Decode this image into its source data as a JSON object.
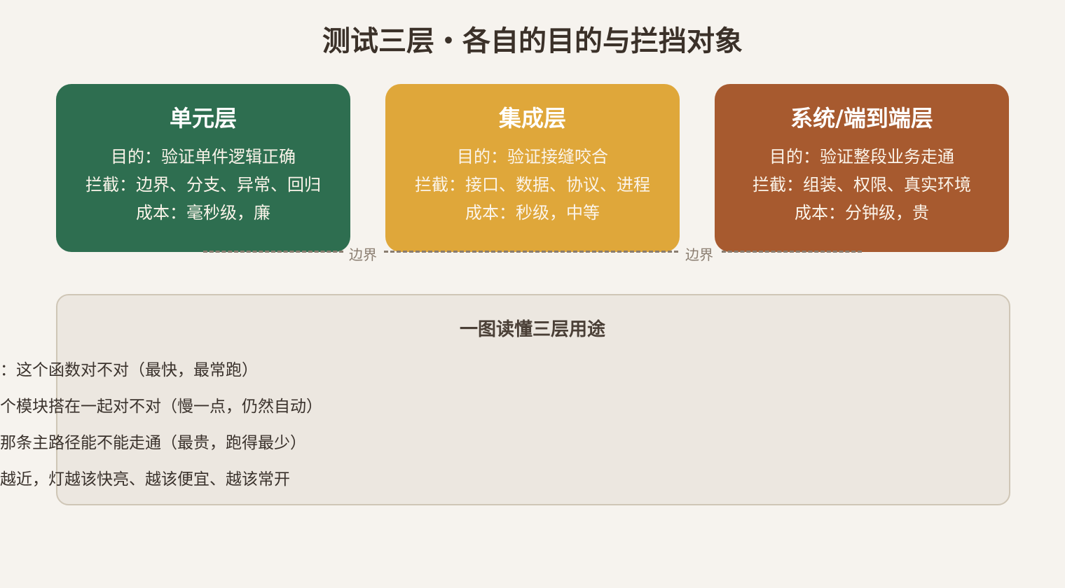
{
  "title": "测试三层・各自的目的与拦挡对象",
  "cards": [
    {
      "title": "单元层",
      "purpose": "目的：验证单件逻辑正确",
      "intercept": "拦截：边界、分支、异常、回归",
      "cost": "成本：毫秒级，廉",
      "color": "#2e6e50"
    },
    {
      "title": "集成层",
      "purpose": "目的：验证接缝咬合",
      "intercept": "拦截：接口、数据、协议、进程",
      "cost": "成本：秒级，中等",
      "color": "#dfa73a"
    },
    {
      "title": "系统/端到端层",
      "purpose": "目的：验证整段业务走通",
      "intercept": "拦截：组装、权限、真实环境",
      "cost": "成本：分钟级，贵",
      "color": "#a75a2f"
    }
  ],
  "boundaries": [
    "边界",
    "边界"
  ],
  "summary": {
    "title": "一图读懂三层用途",
    "lines": [
      "：这个函数对不对（最快，最常跑）",
      "个模块搭在一起对不对（慢一点，仍然自动）",
      "那条主路径能不能走通（最贵，跑得最少）",
      "越近，灯越该快亮、越该便宜、越该常开"
    ]
  }
}
